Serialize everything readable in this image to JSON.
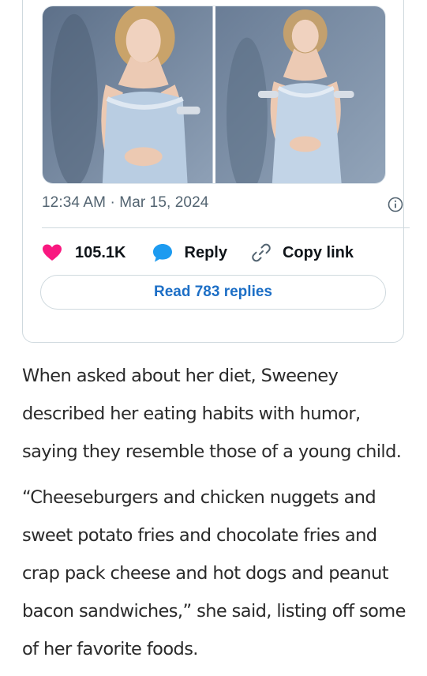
{
  "tweet": {
    "timestamp": "12:34 AM · Mar 15, 2024",
    "likes_count": "105.1K",
    "reply_label": "Reply",
    "copy_link_label": "Copy link",
    "read_replies_label": "Read 783 replies",
    "icons": {
      "like": "heart-icon",
      "reply": "speech-bubble-icon",
      "copy": "link-icon",
      "info": "info-icon"
    },
    "colors": {
      "like": "#f91880",
      "reply": "#1d9bf0",
      "link": "#1d6fc6",
      "muted": "#536471"
    }
  },
  "article": {
    "paragraphs": [
      "When asked about her diet, Sweeney described her eating habits with humor, saying they resemble those of a young child.",
      "“Cheeseburgers and chicken nuggets and sweet potato fries and chocolate fries and crap pack cheese and hot dogs and peanut bacon sandwiches,” she said, listing off some of her favorite foods."
    ]
  }
}
